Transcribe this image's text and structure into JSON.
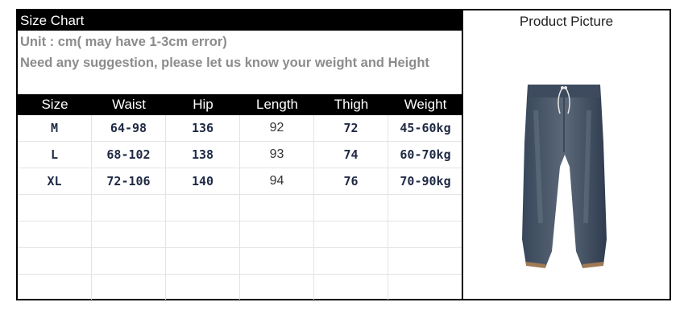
{
  "size_chart": {
    "title": "Size Chart",
    "unit_note": "Unit : cm( may have 1-3cm error)",
    "suggestion_note": "Need any suggestion, please let us know your weight and Height",
    "headers": [
      "Size",
      "Waist",
      "Hip",
      "Length",
      "Thigh",
      "Weight"
    ],
    "rows": [
      [
        "M",
        "64-98",
        "136",
        "92",
        "72",
        "45-60kg"
      ],
      [
        "L",
        "68-102",
        "138",
        "93",
        "74",
        "60-70kg"
      ],
      [
        "XL",
        "72-106",
        "140",
        "94",
        "76",
        "70-90kg"
      ]
    ]
  },
  "product": {
    "title": "Product Picture",
    "image_icon": "jeans-pants-image"
  },
  "colors": {
    "header_bg": "#000000",
    "note_gray": "#8c8c8c",
    "value_navy": "#1f2a44",
    "denim": "#4a5a6a"
  }
}
